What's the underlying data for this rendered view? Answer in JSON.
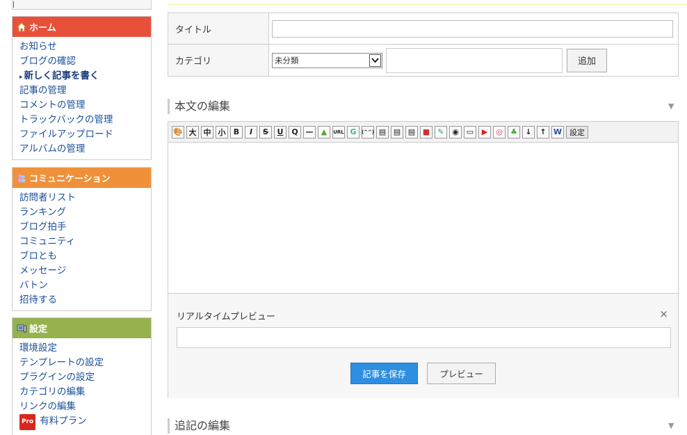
{
  "sidebar": {
    "home": {
      "title": "ホーム",
      "color": "#e8503a",
      "items": [
        {
          "label": "お知らせ"
        },
        {
          "label": "ブログの確認"
        },
        {
          "label": "新しく記事を書く",
          "active": true
        },
        {
          "label": "記事の管理"
        },
        {
          "label": "コメントの管理"
        },
        {
          "label": "トラックバックの管理"
        },
        {
          "label": "ファイルアップロード"
        },
        {
          "label": "アルバムの管理"
        }
      ]
    },
    "communication": {
      "title": "コミュニケーション",
      "color": "#f0913a",
      "items": [
        {
          "label": "訪問者リスト"
        },
        {
          "label": "ランキング"
        },
        {
          "label": "ブログ拍手"
        },
        {
          "label": "コミュニティ"
        },
        {
          "label": "ブロとも"
        },
        {
          "label": "メッセージ"
        },
        {
          "label": "バトン"
        },
        {
          "label": "招待する"
        }
      ]
    },
    "settings": {
      "title": "設定",
      "color": "#95b24f",
      "items": [
        {
          "label": "環境設定"
        },
        {
          "label": "テンプレートの設定"
        },
        {
          "label": "プラグインの設定"
        },
        {
          "label": "カテゴリの編集"
        },
        {
          "label": "リンクの編集"
        },
        {
          "label": "有料プラン",
          "badge": "Pro"
        }
      ]
    }
  },
  "form": {
    "title_label": "タイトル",
    "title_value": "",
    "category_label": "カテゴリ",
    "category_selected": "未分類",
    "category_new_value": "",
    "add_button": "追加"
  },
  "body_section": {
    "title": "本文の編集",
    "toolbar_buttons": [
      "palette",
      "大",
      "中",
      "小",
      "B",
      "I",
      "S",
      "U",
      "Q",
      "—",
      "image",
      "URL",
      "G",
      "(^^)",
      "doc1",
      "doc2",
      "doc3",
      "flag",
      "pen",
      "rec",
      "tv",
      "YouTube",
      "instagram",
      "evernote",
      "↓",
      "↑",
      "W"
    ],
    "toolbar_settings": "設定",
    "preview_label": "リアルタイムプレビュー",
    "close_glyph": "×",
    "save_button": "記事を保存",
    "preview_button": "プレビュー"
  },
  "extra_section": {
    "title": "追記の編集"
  },
  "collapse_glyph": "▼",
  "caret_glyph": "▸"
}
